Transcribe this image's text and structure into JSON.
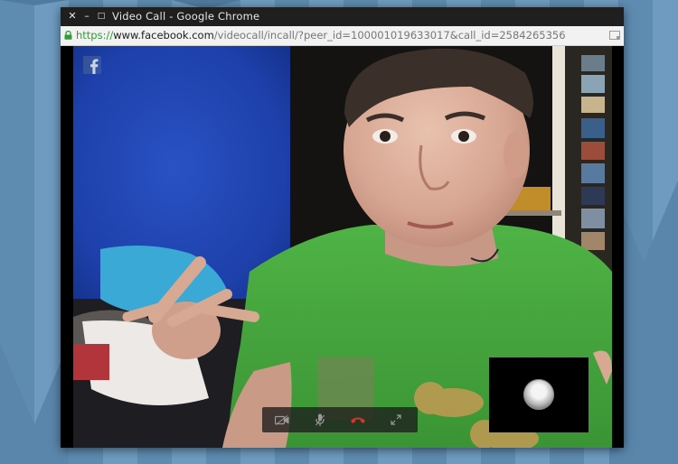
{
  "window": {
    "title": "Video Call - Google Chrome",
    "close_glyph": "✕",
    "minimize_glyph": "–",
    "maximize_glyph": "□"
  },
  "address_bar": {
    "scheme": "https://",
    "host": "www.facebook.com",
    "path": "/videocall/incall/?peer_id=100001019633017&call_id=2584265356",
    "lock_icon": "lock-icon",
    "secure_color": "#2e9c37"
  },
  "video_call": {
    "brand_icon": "facebook-icon",
    "controls": [
      {
        "name": "camera-toggle-button",
        "icon": "video-camera-icon"
      },
      {
        "name": "mute-button",
        "icon": "microphone-icon"
      },
      {
        "name": "end-call-button",
        "icon": "hang-up-icon",
        "color": "#d9342b"
      },
      {
        "name": "fullscreen-button",
        "icon": "expand-icon"
      }
    ],
    "self_view_icon": "self-avatar-icon"
  },
  "colors": {
    "titlebar": "#1f1f1f",
    "addressbar": "#f2f2f2",
    "end_call": "#d9342b",
    "wall": "#1b3ea8",
    "shirt": "#45a83d"
  }
}
